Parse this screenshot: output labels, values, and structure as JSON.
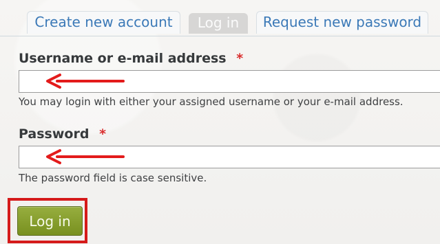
{
  "tabs": [
    {
      "label": "Create new account"
    },
    {
      "label": "Log in"
    },
    {
      "label": "Request new password"
    }
  ],
  "form": {
    "username": {
      "label": "Username or e-mail address",
      "required_marker": "*",
      "value": "",
      "description": "You may login with either your assigned username or your e-mail address."
    },
    "password": {
      "label": "Password",
      "required_marker": "*",
      "value": "",
      "description": "The password field is case sensitive."
    },
    "submit_label": "Log in"
  },
  "annotations": {
    "arrow_color": "#e31b1b",
    "highlight_color": "#d51a1a"
  }
}
